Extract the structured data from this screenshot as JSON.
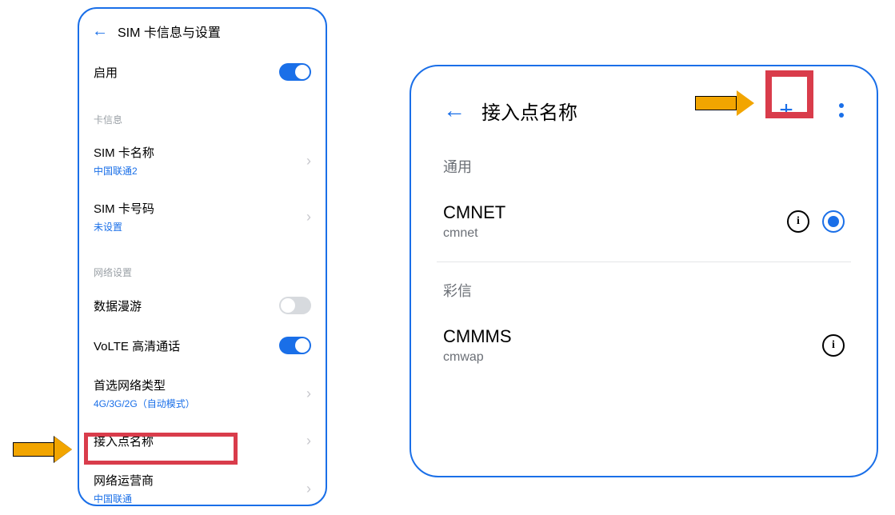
{
  "left_panel": {
    "header_title": "SIM 卡信息与设置",
    "enable_label": "启用",
    "section_card_info": "卡信息",
    "sim_name_label": "SIM 卡名称",
    "sim_name_value": "中国联通2",
    "sim_number_label": "SIM 卡号码",
    "sim_number_value": "未设置",
    "section_network": "网络设置",
    "data_roaming_label": "数据漫游",
    "volte_label": "VoLTE 高清通话",
    "pref_network_label": "首选网络类型",
    "pref_network_value": "4G/3G/2G（自动模式）",
    "apn_label": "接入点名称",
    "carrier_label": "网络运营商",
    "carrier_value": "中国联通"
  },
  "right_panel": {
    "header_title": "接入点名称",
    "section_general": "通用",
    "apn1_title": "CMNET",
    "apn1_sub": "cmnet",
    "section_mms": "彩信",
    "apn2_title": "CMMMS",
    "apn2_sub": "cmwap"
  }
}
